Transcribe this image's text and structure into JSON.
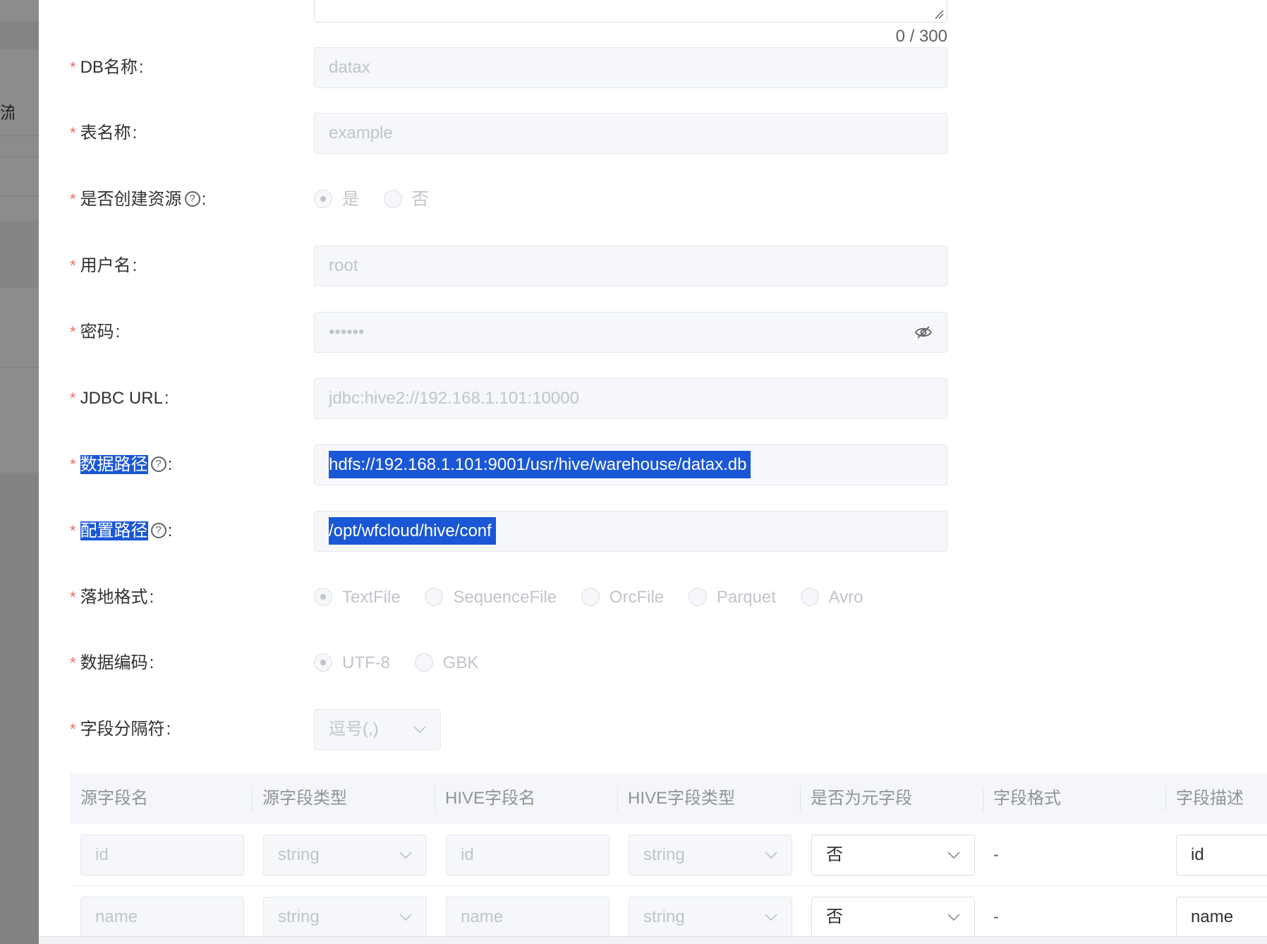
{
  "background_sidebar": {
    "glyph": "流"
  },
  "form": {
    "description": {
      "counter": "0 / 300"
    },
    "fields": {
      "db_name": {
        "label": "DB名称",
        "value": "datax"
      },
      "table_name": {
        "label": "表名称",
        "value": "example"
      },
      "create_resource": {
        "label": "是否创建资源",
        "options": [
          "是",
          "否"
        ],
        "selected": "是"
      },
      "username": {
        "label": "用户名",
        "value": "root"
      },
      "password": {
        "label": "密码",
        "value": "••••••"
      },
      "jdbc_url": {
        "label": "JDBC URL",
        "value": "jdbc:hive2://192.168.1.101:10000"
      },
      "data_path": {
        "label": "数据路径",
        "value": "hdfs://192.168.1.101:9001/usr/hive/warehouse/datax.db"
      },
      "config_path": {
        "label": "配置路径",
        "value": "/opt/wfcloud/hive/conf"
      },
      "file_format": {
        "label": "落地格式",
        "options": [
          "TextFile",
          "SequenceFile",
          "OrcFile",
          "Parquet",
          "Avro"
        ],
        "selected": "TextFile"
      },
      "encoding": {
        "label": "数据编码",
        "options": [
          "UTF-8",
          "GBK"
        ],
        "selected": "UTF-8"
      },
      "delimiter": {
        "label": "字段分隔符",
        "value": "逗号(,)"
      }
    },
    "colon": ":",
    "help": "?"
  },
  "field_table": {
    "headers": [
      "源字段名",
      "源字段类型",
      "HIVE字段名",
      "HIVE字段类型",
      "是否为元字段",
      "字段格式",
      "字段描述"
    ],
    "rows": [
      {
        "source_name": "id",
        "source_type": "string",
        "hive_name": "id",
        "hive_type": "string",
        "is_meta": "否",
        "format": "-",
        "description": "id"
      },
      {
        "source_name": "name",
        "source_type": "string",
        "hive_name": "name",
        "hive_type": "string",
        "is_meta": "否",
        "format": "-",
        "description": "name"
      }
    ]
  },
  "colors": {
    "required": "#f56c6c",
    "selection": "#1a57d6",
    "disabled_bg": "#f5f7fa"
  }
}
